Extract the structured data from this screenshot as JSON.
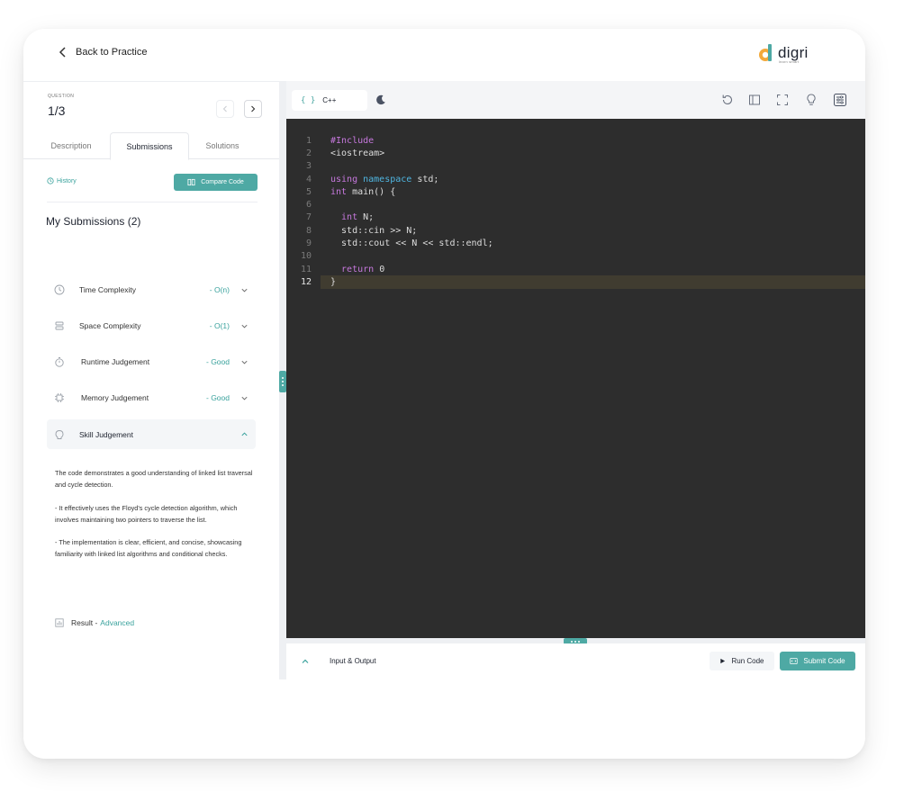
{
  "header": {
    "back_label": "Back to Practice",
    "logo_text": "digri",
    "logo_sub": "learn smart",
    "brand_colors": [
      "#f3a93b",
      "#4ea9a4"
    ]
  },
  "question": {
    "label": "QUESTION",
    "number": "1/3"
  },
  "tabs": [
    {
      "label": "Description",
      "active": false
    },
    {
      "label": "Submissions",
      "active": true
    },
    {
      "label": "Solutions",
      "active": false
    }
  ],
  "history_label": "History",
  "compare_label": "Compare Code",
  "submissions_title": "My Submissions (2)",
  "metrics": [
    {
      "label": "Time Complexity",
      "value": "- O(n)",
      "icon": "clock-icon"
    },
    {
      "label": "Space Complexity",
      "value": "- O(1)",
      "icon": "database-icon"
    },
    {
      "label": "Runtime Judgement",
      "value": "- Good",
      "icon": "stopwatch-icon"
    },
    {
      "label": "Memory Judgement",
      "value": "- Good",
      "icon": "chip-icon"
    },
    {
      "label": "Skill Judgement",
      "value": "",
      "icon": "brain-icon",
      "expanded": true
    }
  ],
  "skill_text": [
    "The code demonstrates a good understanding of linked list traversal and cycle detection.",
    "- It effectively uses the Floyd's cycle detection algorithm, which involves maintaining two pointers to traverse the list.",
    "- The implementation is clear, efficient, and concise, showcasing familiarity with linked list algorithms and conditional checks."
  ],
  "result": {
    "label": "Result -",
    "value": "Advanced"
  },
  "editor": {
    "language": "C++",
    "braces": "{ }",
    "active_line": 12,
    "lines": [
      {
        "n": "1",
        "parts": [
          {
            "t": "#Include",
            "c": "kw"
          }
        ]
      },
      {
        "n": "2",
        "parts": [
          {
            "t": "<iostream>",
            "c": ""
          }
        ]
      },
      {
        "n": "3",
        "parts": []
      },
      {
        "n": "4",
        "parts": [
          {
            "t": "using ",
            "c": "kw"
          },
          {
            "t": "namespace",
            "c": "kb"
          },
          {
            "t": " std;",
            "c": ""
          }
        ]
      },
      {
        "n": "5",
        "parts": [
          {
            "t": "int",
            "c": "kw"
          },
          {
            "t": " main() {",
            "c": ""
          }
        ]
      },
      {
        "n": "6",
        "parts": []
      },
      {
        "n": "7",
        "parts": [
          {
            "t": "  int",
            "c": "kw"
          },
          {
            "t": " N;",
            "c": ""
          }
        ]
      },
      {
        "n": "8",
        "parts": [
          {
            "t": "  std::cin >> N;",
            "c": ""
          }
        ]
      },
      {
        "n": "9",
        "parts": [
          {
            "t": "  std::cout << N << std::endl;",
            "c": ""
          }
        ]
      },
      {
        "n": "10",
        "parts": []
      },
      {
        "n": "11",
        "parts": [
          {
            "t": "  return",
            "c": "kw"
          },
          {
            "t": " 0",
            "c": ""
          }
        ]
      },
      {
        "n": "12",
        "parts": [
          {
            "t": "}",
            "c": ""
          }
        ]
      }
    ]
  },
  "io_label": "Input & Output",
  "run_label": "Run Code",
  "submit_label": "Submit Code"
}
